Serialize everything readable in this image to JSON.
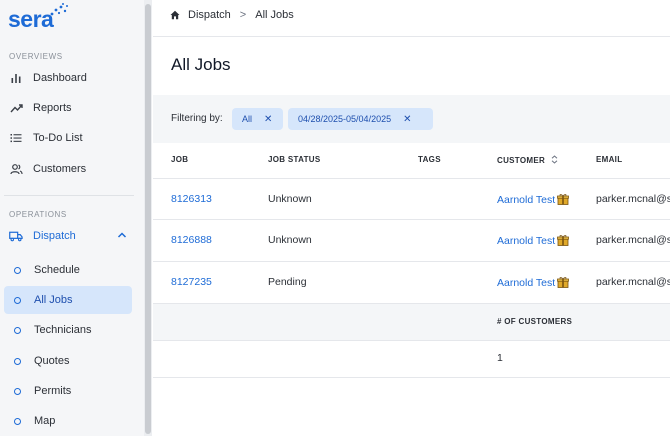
{
  "app": {
    "logo_text": "sera"
  },
  "sidebar": {
    "sections": [
      {
        "label": "OVERVIEWS"
      },
      {
        "label": "OPERATIONS"
      }
    ],
    "items": [
      {
        "label": "Dashboard",
        "icon": "bar-chart-icon"
      },
      {
        "label": "Reports",
        "icon": "trend-icon"
      },
      {
        "label": "To-Do List",
        "icon": "list-icon"
      },
      {
        "label": "Customers",
        "icon": "users-icon"
      },
      {
        "label": "Dispatch",
        "icon": "truck-icon",
        "expanded": true
      }
    ],
    "subitems": [
      {
        "label": "Schedule"
      },
      {
        "label": "All Jobs",
        "active": true
      },
      {
        "label": "Technicians"
      },
      {
        "label": "Quotes"
      },
      {
        "label": "Permits"
      },
      {
        "label": "Map"
      }
    ]
  },
  "breadcrumb": {
    "home": "Dispatch",
    "separator": ">",
    "current": "All Jobs"
  },
  "page": {
    "title": "All Jobs"
  },
  "filters": {
    "label": "Filtering by:",
    "chips": [
      {
        "label": "All",
        "remove": "✕"
      },
      {
        "label": "04/28/2025-05/04/2025",
        "remove": "✕"
      }
    ]
  },
  "table": {
    "columns": [
      "JOB",
      "JOB STATUS",
      "TAGS",
      "CUSTOMER",
      "EMAIL"
    ],
    "rows": [
      {
        "job": "8126313",
        "status": "Unknown",
        "tags": "",
        "customer": "Aarnold Test",
        "email": "parker.mcnal@s"
      },
      {
        "job": "8126888",
        "status": "Unknown",
        "tags": "",
        "customer": "Aarnold Test",
        "email": "parker.mcnal@s"
      },
      {
        "job": "8127235",
        "status": "Pending",
        "tags": "",
        "customer": "Aarnold Test",
        "email": "parker.mcnal@s"
      }
    ],
    "summary": {
      "label": "# OF CUSTOMERS",
      "value": "1"
    }
  },
  "colors": {
    "accent": "#1e6bd6",
    "active_bg": "#d6e6fb",
    "sidebar_bg": "#f5f6f8"
  }
}
